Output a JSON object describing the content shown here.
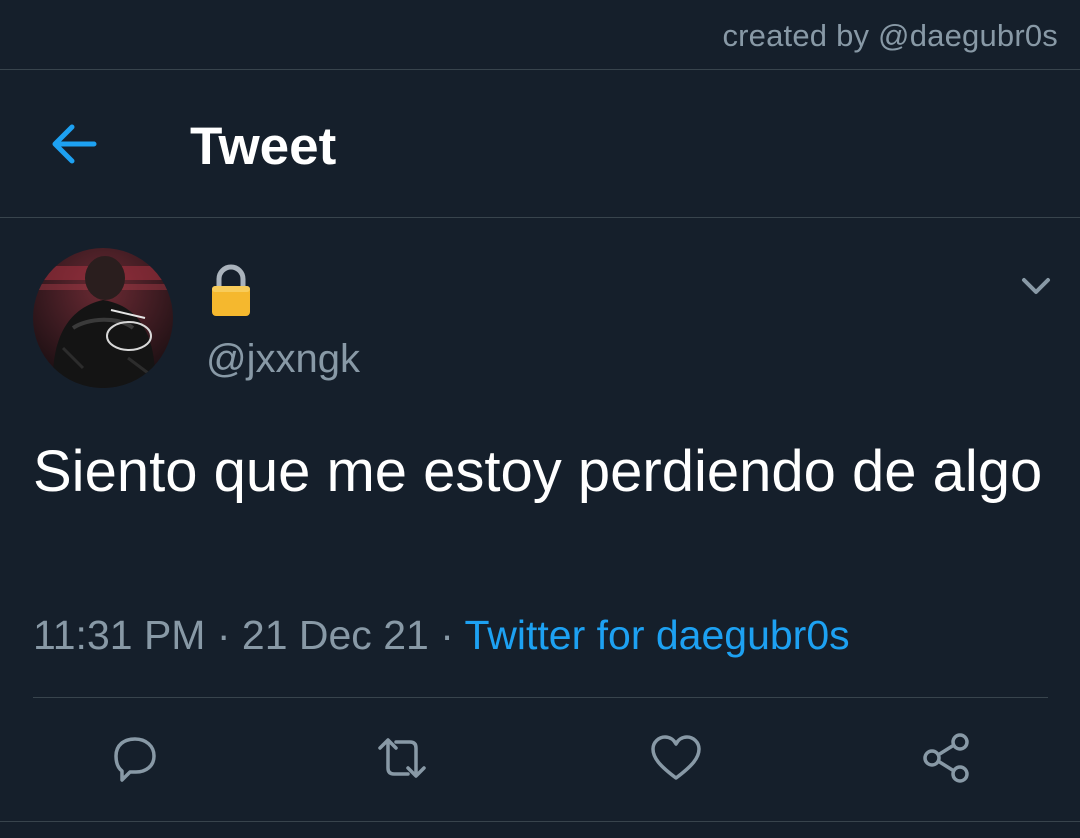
{
  "credit": "created by @daegubr0s",
  "header": {
    "title": "Tweet"
  },
  "tweet": {
    "handle": "@jxxngk",
    "text": "Siento que me estoy perdiendo de algo",
    "time": "11:31 PM",
    "date": "21 Dec 21",
    "source": "Twitter for daegubr0s",
    "separator": " · "
  },
  "icons": {
    "back": "arrow-left-icon",
    "lock": "lock-icon",
    "menu": "chevron-down-icon",
    "reply": "reply-icon",
    "retweet": "retweet-icon",
    "like": "heart-icon",
    "share": "share-icon"
  },
  "colors": {
    "background": "#151f2b",
    "accent": "#1da1f2",
    "muted": "#8899a6",
    "divider": "#38444d"
  }
}
